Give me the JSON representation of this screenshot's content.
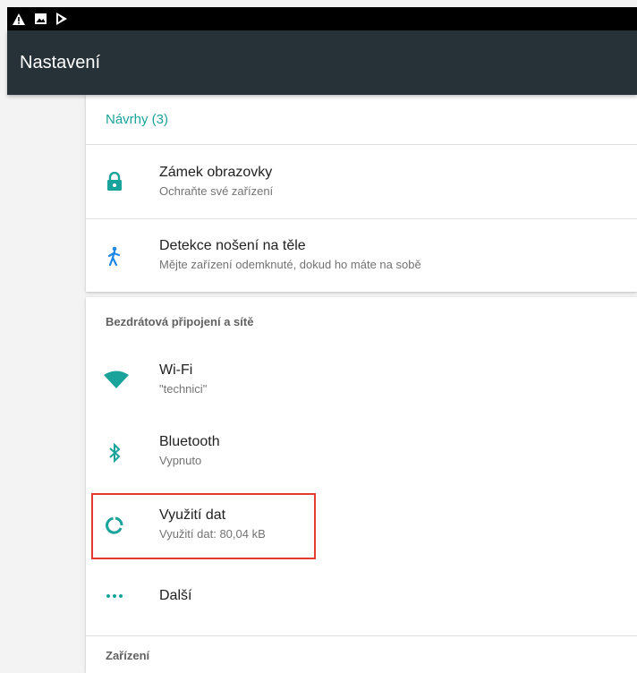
{
  "status_bar": {
    "icons": [
      "warning-icon",
      "image-icon",
      "play-store-icon"
    ]
  },
  "toolbar": {
    "title": "Nastavení"
  },
  "suggestions": {
    "header": "Návrhy (3)",
    "items": [
      {
        "icon": "lock-icon",
        "title": "Zámek obrazovky",
        "subtitle": "Ochraňte své zařízení"
      },
      {
        "icon": "person-walking-icon",
        "title": "Detekce nošení na těle",
        "subtitle": "Mějte zařízení odemknuté, dokud ho máte na sobě"
      }
    ]
  },
  "wireless_section": {
    "title": "Bezdrátová připojení a sítě",
    "items": [
      {
        "icon": "wifi-icon",
        "title": "Wi-Fi",
        "subtitle": "\"technici\""
      },
      {
        "icon": "bluetooth-icon",
        "title": "Bluetooth",
        "subtitle": "Vypnuto"
      },
      {
        "icon": "data-usage-icon",
        "title": "Využití dat",
        "subtitle": "Využití dat: 80,04 kB"
      },
      {
        "icon": "more-icon",
        "title": "Další",
        "subtitle": ""
      }
    ]
  },
  "device_section": {
    "title": "Zařízení"
  },
  "colors": {
    "accent": "#1aa39a",
    "toolbar": "#263238",
    "highlight": "#e53935"
  }
}
